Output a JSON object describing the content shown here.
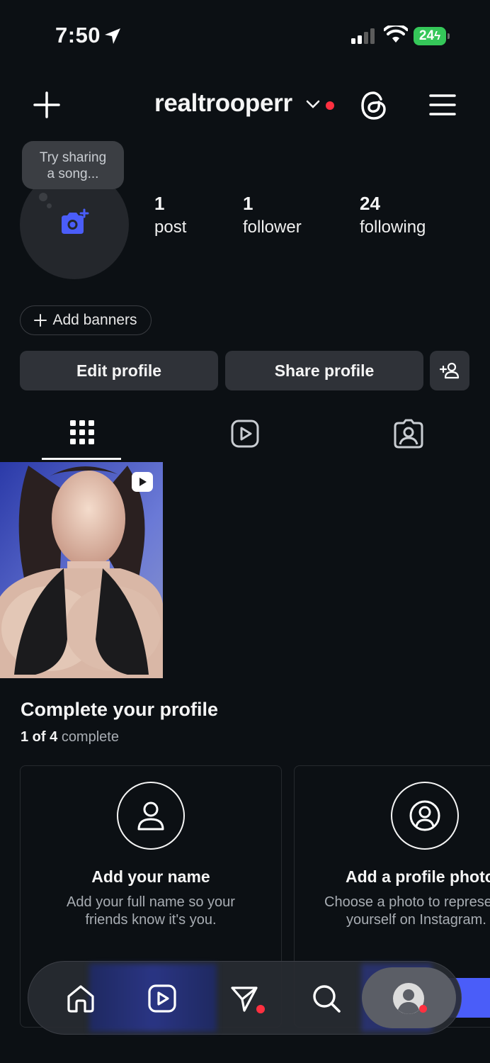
{
  "status_bar": {
    "time": "7:50",
    "battery": "24"
  },
  "header": {
    "username": "realtrooperr"
  },
  "profile": {
    "note_tooltip": [
      "Try sharing",
      "a song..."
    ],
    "stats": [
      {
        "count": "1",
        "label": "post"
      },
      {
        "count": "1",
        "label": "follower"
      },
      {
        "count": "24",
        "label": "following"
      }
    ],
    "add_banners_label": "Add banners",
    "edit_profile_label": "Edit profile",
    "share_profile_label": "Share profile"
  },
  "tabs": [
    {
      "name": "grid-tab",
      "active": true
    },
    {
      "name": "reels-tab",
      "active": false
    },
    {
      "name": "tagged-tab",
      "active": false
    }
  ],
  "complete_profile": {
    "title": "Complete your profile",
    "progress_done": "1 of 4",
    "progress_suffix": "complete",
    "cards": [
      {
        "title": "Add your name",
        "desc_line1": "Add your full name so your",
        "desc_line2": "friends know it's you.",
        "icon": "person-icon"
      },
      {
        "title": "Add a profile photo",
        "desc_line1": "Choose a photo to represent",
        "desc_line2": "yourself on Instagram.",
        "icon": "profile-photo-icon"
      }
    ]
  },
  "colors": {
    "background": "#0c1014",
    "button": "#2f3238",
    "accent_blue": "#4a5df9",
    "notification_red": "#ff3040",
    "battery_green": "#35c759"
  },
  "nav": [
    "home-icon",
    "reels-icon",
    "direct-icon",
    "search-icon",
    "profile-avatar-icon"
  ]
}
